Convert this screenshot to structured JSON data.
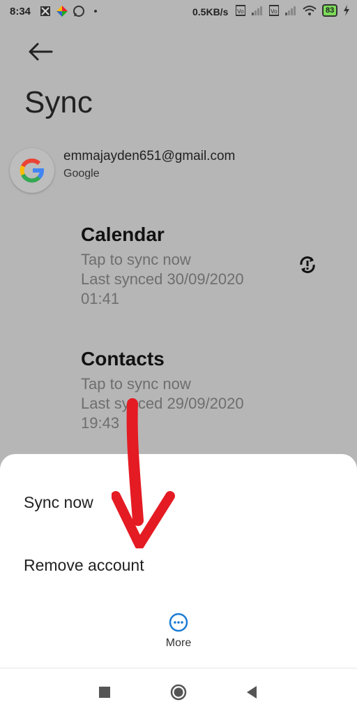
{
  "status_bar": {
    "time": "8:34",
    "network_speed": "0.5KB/s",
    "battery": "83",
    "icons": [
      "app-icon",
      "pinwheel-icon",
      "whatsapp-icon",
      "dot-icon",
      "volte-icon",
      "signal-icon",
      "volte-icon",
      "signal-icon",
      "wifi-icon",
      "battery-icon",
      "charging-icon"
    ]
  },
  "header": {
    "back_icon": "back-arrow-icon",
    "title": "Sync"
  },
  "account": {
    "email": "emmajayden651@gmail.com",
    "type": "Google",
    "icon": "google-logo-icon"
  },
  "sync_items": [
    {
      "name": "Calendar",
      "status": "Tap to sync now",
      "last_synced": "Last synced 30/09/2020",
      "time": "01:41"
    },
    {
      "name": "Contacts",
      "status": "Tap to sync now",
      "last_synced": "Last synced 29/09/2020",
      "time": "19:43"
    }
  ],
  "sheet": {
    "sync_now": "Sync now",
    "remove_account": "Remove account",
    "more": "More"
  },
  "colors": {
    "dim_background": "#b6b6b6",
    "accent": "#1a7bd4",
    "annotation_arrow": "#e41b23"
  }
}
